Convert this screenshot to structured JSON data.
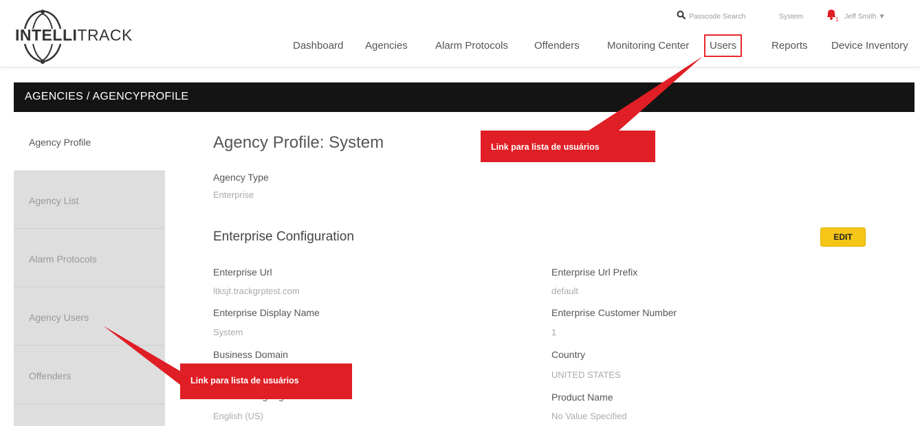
{
  "brand": {
    "logo_text_bold": "INTELLI",
    "logo_text_light": "TRACK"
  },
  "header": {
    "search_label": "Passcode Search",
    "agency_label": "System",
    "user_name": "Jeff Smith",
    "nav": [
      "Dashboard",
      "Agencies",
      "Alarm Protocols",
      "Offenders",
      "Monitoring Center",
      "Users",
      "Reports",
      "Device Inventory"
    ]
  },
  "breadcrumb": "AGENCIES / AGENCYPROFILE",
  "sidebar": {
    "items": [
      {
        "label": "Agency Profile",
        "active": true
      },
      {
        "label": "Agency List",
        "active": false
      },
      {
        "label": "Alarm Protocols",
        "active": false
      },
      {
        "label": "Agency Users",
        "active": false
      },
      {
        "label": "Offenders",
        "active": false
      }
    ]
  },
  "main": {
    "title": "Agency Profile: System",
    "agency_type_label": "Agency Type",
    "agency_type_value": "Enterprise",
    "section_title": "Enterprise Configuration",
    "edit_label": "EDIT",
    "fields": {
      "enterprise_url_label": "Enterprise Url",
      "enterprise_url_value": "ltksjt.trackgrptest.com",
      "enterprise_url_prefix_label": "Enterprise Url Prefix",
      "enterprise_url_prefix_value": "default",
      "enterprise_display_name_label": "Enterprise Display Name",
      "enterprise_display_name_value": "System",
      "enterprise_customer_number_label": "Enterprise Customer Number",
      "enterprise_customer_number_value": "1",
      "business_domain_label": "Business Domain",
      "country_label": "Country",
      "country_value": "UNITED STATES",
      "default_language_label": "Default Language",
      "default_language_value": "English (US)",
      "product_name_label": "Product Name",
      "product_name_value": "No Value Specified"
    }
  },
  "annotations": {
    "top_callout": "Link para lista de usuários",
    "bottom_callout": "Link para lista de usuários"
  },
  "colors": {
    "accent_red": "#e01e25",
    "edit_yellow": "#f5c518",
    "bar_black": "#141414"
  }
}
